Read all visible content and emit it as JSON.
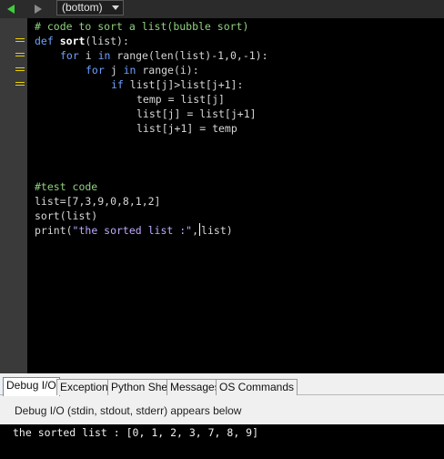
{
  "toolbar": {
    "scope": "(bottom)",
    "back_icon": "arrow-left-icon",
    "forward_icon": "arrow-right-icon",
    "back_color": "#3ccf3c",
    "forward_color": "#8a8a8a"
  },
  "editor": {
    "code": {
      "l1": "# code to sort a list(bubble sort)",
      "l2_kw": "def",
      "l2_fn": "sort",
      "l2_rest": "(list):",
      "l3_kw1": "for",
      "l3_mid": " i ",
      "l3_kw2": "in",
      "l3_rest": " range(len(list)-1,0,-1):",
      "l4_kw1": "for",
      "l4_mid": " j ",
      "l4_kw2": "in",
      "l4_rest": " range(i):",
      "l5_kw": "if",
      "l5_rest": " list[j]>list[j+1]:",
      "l6": "temp = list[j]",
      "l7": "list[j] = list[j+1]",
      "l8": "list[j+1] = temp",
      "l9": "#test code",
      "l10": "list=[7,3,9,0,8,1,2]",
      "l11": "sort(list)",
      "l12_a": "print(",
      "l12_str": "\"the sorted list :\"",
      "l12_b": ",",
      "l12_c": "list)"
    },
    "colors": {
      "background": "#000000",
      "keyword": "#6ea0ff",
      "comment": "#8fd07e",
      "string": "#bfa9ff",
      "fold_marker": "#e6d000"
    }
  },
  "panel": {
    "tabs": [
      "Debug I/O",
      "Exceptions",
      "Python Shell",
      "Messages",
      "OS Commands"
    ],
    "active_tab": "Debug I/O",
    "description": "Debug I/O (stdin, stdout, stderr) appears below",
    "output": "the sorted list : [0, 1, 2, 3, 7, 8, 9]"
  }
}
